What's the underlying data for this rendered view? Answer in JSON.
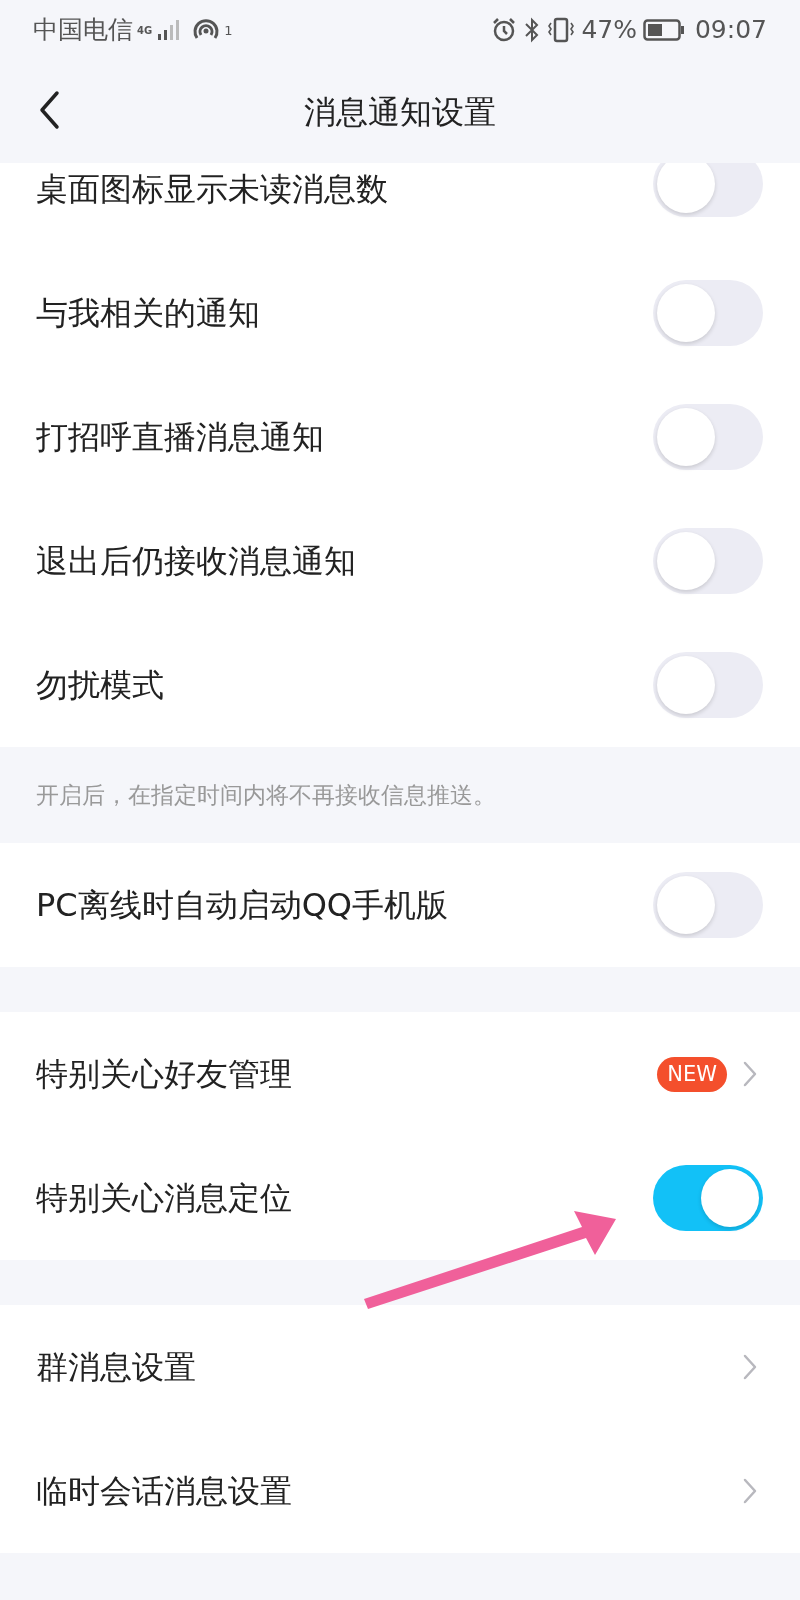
{
  "status_bar": {
    "carrier": "中国电信",
    "network": "4G",
    "hotspot_count": "1",
    "battery": "47%",
    "time": "09:07"
  },
  "header": {
    "title": "消息通知设置"
  },
  "sections": [
    {
      "rows": [
        {
          "kind": "toggle",
          "label": "桌面图标显示未读消息数",
          "on": false,
          "partial": true
        },
        {
          "kind": "toggle",
          "label": "与我相关的通知",
          "on": false,
          "partial": false
        },
        {
          "kind": "toggle",
          "label": "打招呼直播消息通知",
          "on": false,
          "partial": false
        },
        {
          "kind": "toggle",
          "label": "退出后仍接收消息通知",
          "on": false,
          "partial": false
        },
        {
          "kind": "toggle",
          "label": "勿扰模式",
          "on": false,
          "partial": false
        }
      ],
      "note": "开启后，在指定时间内将不再接收信息推送。"
    },
    {
      "rows": [
        {
          "kind": "toggle",
          "label": "PC离线时自动启动QQ手机版",
          "on": false,
          "partial": false
        }
      ]
    },
    {
      "rows": [
        {
          "kind": "link",
          "label": "特别关心好友管理",
          "badge": "NEW",
          "partial": false
        },
        {
          "kind": "toggle",
          "label": "特别关心消息定位",
          "on": true,
          "partial": false
        }
      ]
    },
    {
      "rows": [
        {
          "kind": "link",
          "label": "群消息设置",
          "partial": false
        },
        {
          "kind": "link",
          "label": "临时会话消息设置",
          "partial": false
        }
      ]
    }
  ]
}
